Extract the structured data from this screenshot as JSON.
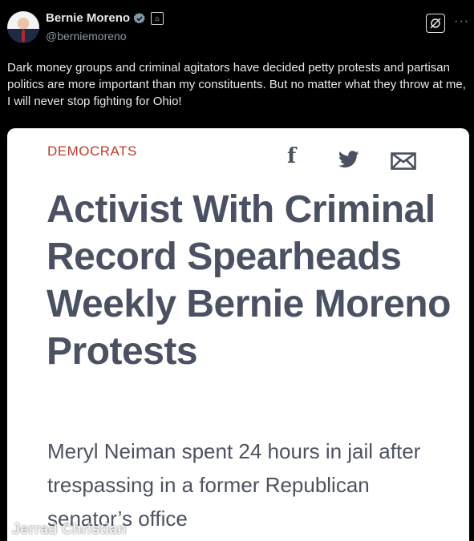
{
  "tweet": {
    "author": {
      "display_name": "Bernie Moreno",
      "handle": "@berniemoreno",
      "verified_icon": "verified-badge-icon",
      "affiliation_icon": "government-building-icon"
    },
    "text": "Dark money groups and criminal agitators have decided petty protests and partisan politics are more important than my constituents. But no matter what they throw at me, I will never stop fighting for Ohio!",
    "actions": {
      "grok_icon": "grok-icon",
      "more_label": "···"
    }
  },
  "article_card": {
    "category": "DEMOCRATS",
    "share": {
      "facebook_label": "f",
      "twitter_icon": "twitter-bird-icon",
      "email_icon": "email-icon"
    },
    "headline": "Activist With Criminal Record Spearheads Weekly Bernie Moreno Protests",
    "subheadline": "Meryl Neiman spent 24 hours in jail after trespassing in a former Republican senator’s office"
  },
  "watermark": "Jerrad Christian",
  "colors": {
    "background": "#000000",
    "text_primary": "#e7e9ea",
    "text_secondary": "#8b98a5",
    "verified": "#829aab",
    "category": "#c0392b",
    "headline": "#4a5162"
  }
}
